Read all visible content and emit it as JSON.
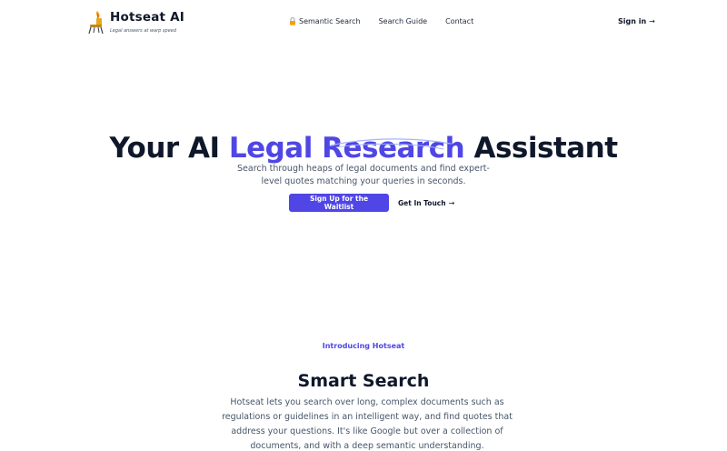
{
  "header": {
    "brand_name": "Hotseat AI",
    "brand_tagline": "Legal answers at warp speed",
    "nav": [
      {
        "label": "Semantic Search",
        "icon": "lock-icon"
      },
      {
        "label": "Search Guide"
      },
      {
        "label": "Contact"
      }
    ],
    "signin_label": "Sign in",
    "arrow": "→"
  },
  "hero": {
    "title_before": "Your AI ",
    "title_accent": "Legal Research",
    "title_after": " Assistant",
    "subtitle": "Search through heaps of legal documents and find expert-level quotes matching your queries in seconds.",
    "primary_button": "Sign Up for the Waitlist",
    "secondary_button": "Get In Touch",
    "arrow": "→"
  },
  "intro": {
    "eyebrow": "Introducing Hotseat",
    "title": "Smart Search",
    "body": "Hotseat lets you search over long, complex documents such as regulations or guidelines in an intelligent way, and find quotes that address your questions. It's like Google but over a collection of documents, and with a deep semantic understanding."
  },
  "colors": {
    "accent": "#4f46e5",
    "text_dark": "#0f172a",
    "text_muted": "#475569"
  }
}
